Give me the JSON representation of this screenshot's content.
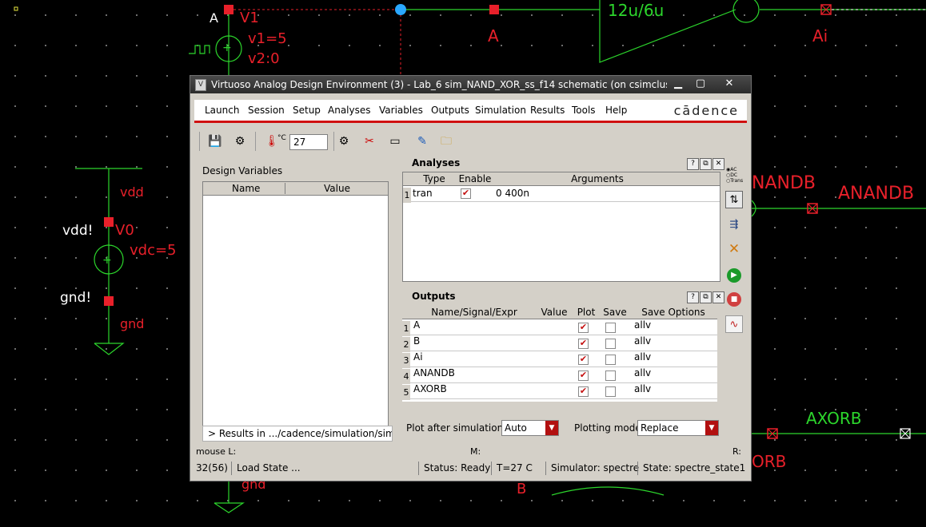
{
  "schematic": {
    "labels": {
      "a_pin": "A",
      "v1_name": "V1",
      "v1_param": "v1=5",
      "v2_param": "v2:0",
      "a_net": "A",
      "inv_size": "12u/6u",
      "ai_net": "Ai",
      "vdd_net": "vdd",
      "vdd_pin": "vdd!",
      "v0_name": "V0",
      "vdc": "vdc=5",
      "gnd_pin": "gnd!",
      "gnd_net": "gnd",
      "nandb_partial": "NANDB",
      "anandb": "ANANDB",
      "axorb": "AXORB",
      "orb_partial": "ORB",
      "b_net": "B",
      "gnd_lower": "gnd"
    },
    "colors": {
      "red": "#e8202a",
      "green": "#2cd62c",
      "white": "#ffffff",
      "cyan": "#2aa8ff"
    }
  },
  "window": {
    "title": "Virtuoso Analog Design Environment (3) - Lab_6 sim_NAND_XOR_ss_f14 schematic (on csimcluster.ee.unl...",
    "controls": {
      "minimize": "▁",
      "maximize": "▢",
      "close": "✕"
    },
    "menu": [
      "Launch",
      "Session",
      "Setup",
      "Analyses",
      "Variables",
      "Outputs",
      "Simulation",
      "Results",
      "Tools",
      "Help"
    ],
    "logo": "cādence",
    "toolbar": {
      "temp_unit": "°C",
      "temperature": "27"
    },
    "design_variables": {
      "label": "Design Variables",
      "columns": [
        "Name",
        "Value"
      ],
      "results_path": "> Results in .../cadence/simulation/sim_NA"
    },
    "analyses": {
      "title": "Analyses",
      "columns": [
        "Type",
        "Enable",
        "Arguments"
      ],
      "rows": [
        {
          "num": "1",
          "type": "tran",
          "enable": true,
          "arguments": "0 400n"
        }
      ]
    },
    "outputs": {
      "title": "Outputs",
      "columns": [
        "Name/Signal/Expr",
        "Value",
        "Plot",
        "Save",
        "Save Options"
      ],
      "rows": [
        {
          "num": "1",
          "name": "A",
          "value": "",
          "plot": true,
          "save": false,
          "save_options": "allv"
        },
        {
          "num": "2",
          "name": "B",
          "value": "",
          "plot": true,
          "save": false,
          "save_options": "allv"
        },
        {
          "num": "3",
          "name": "Ai",
          "value": "",
          "plot": true,
          "save": false,
          "save_options": "allv"
        },
        {
          "num": "4",
          "name": "ANANDB",
          "value": "",
          "plot": true,
          "save": false,
          "save_options": "allv"
        },
        {
          "num": "5",
          "name": "AXORB",
          "value": "",
          "plot": true,
          "save": false,
          "save_options": "allv"
        }
      ]
    },
    "panel_buttons": [
      "?",
      "⧉",
      "✕"
    ],
    "analysis_radio": [
      "AC",
      "DC",
      "Trans"
    ],
    "plot_after": {
      "label": "Plot after simulation:",
      "value": "Auto"
    },
    "plot_mode": {
      "label": "Plotting mode:",
      "value": "Replace"
    },
    "mouse_bar": {
      "left": "mouse L:",
      "middle": "M:",
      "right": "R:"
    },
    "status": {
      "line": "32(56)",
      "message": "Load State ...",
      "status": "Status: Ready",
      "temp": "T=27   C",
      "simulator": "Simulator: spectre",
      "state": "State: spectre_state1"
    }
  }
}
